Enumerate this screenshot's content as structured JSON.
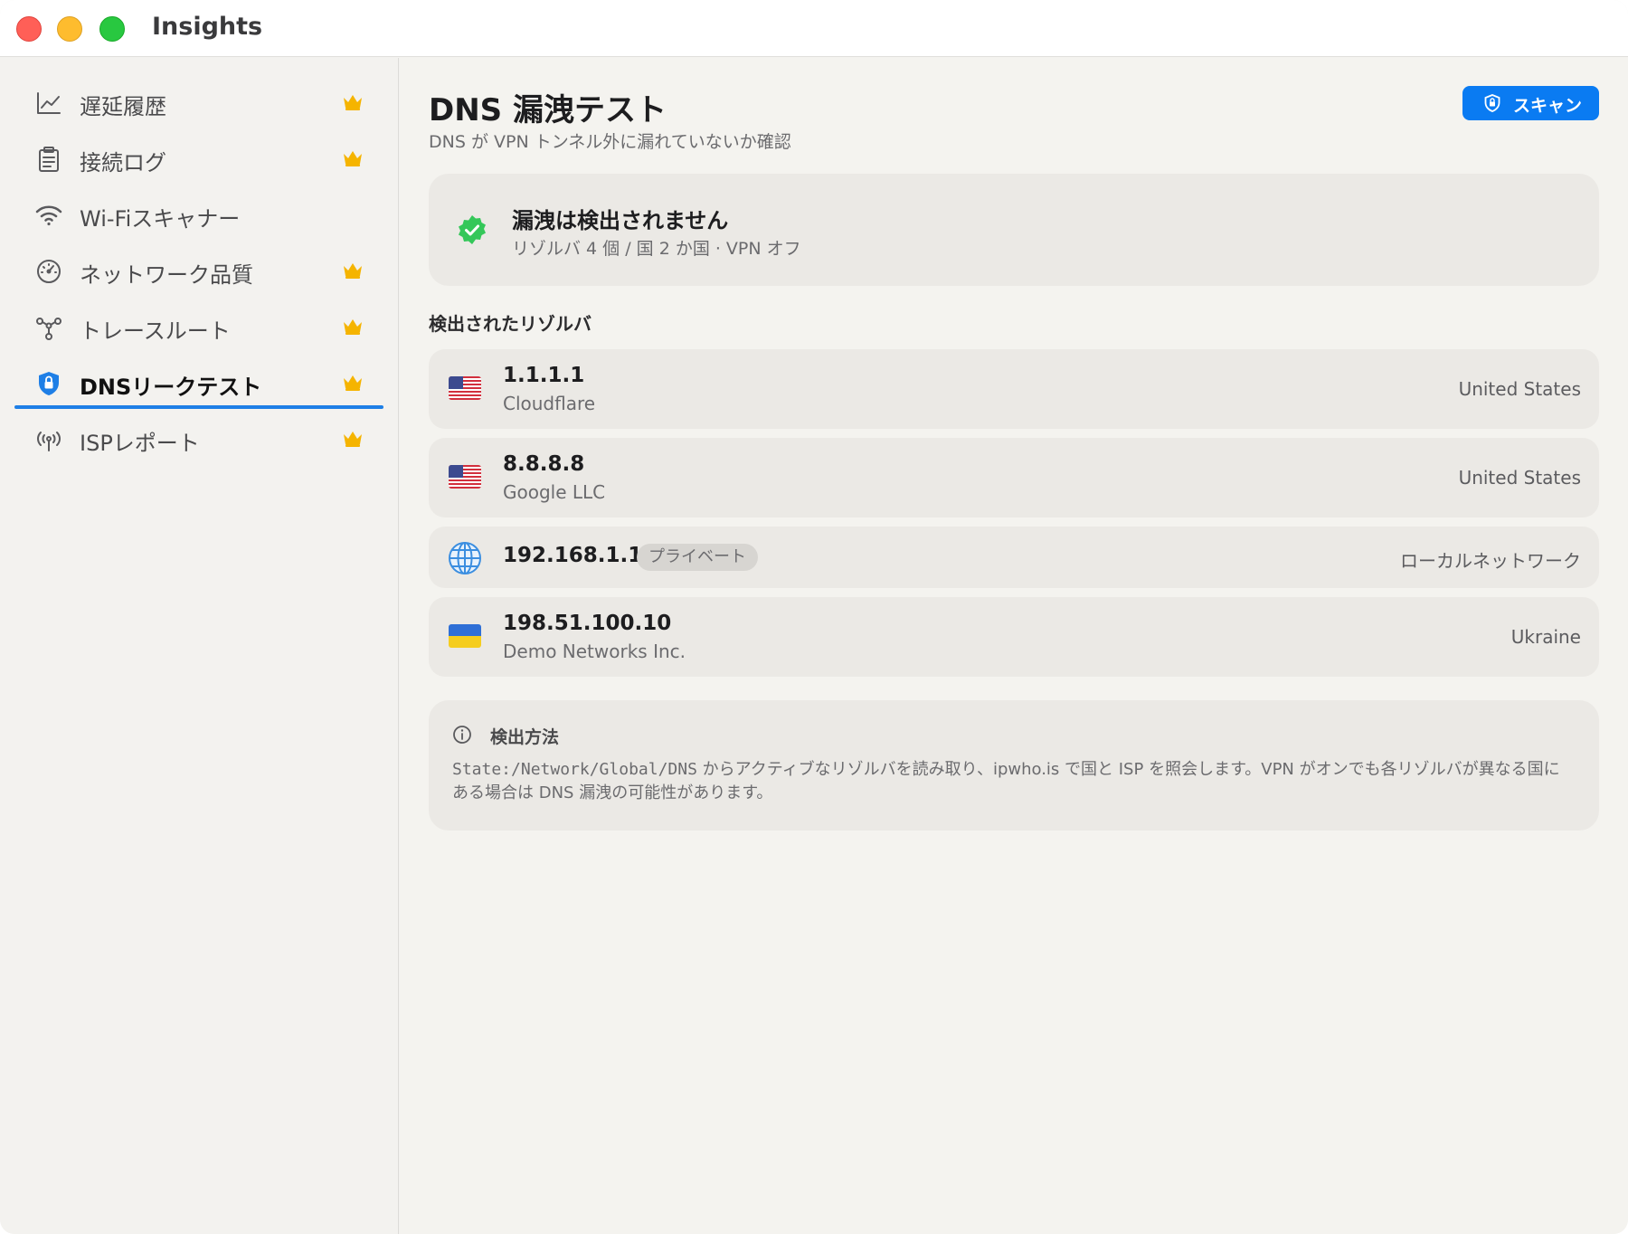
{
  "window": {
    "title": "Insights"
  },
  "sidebar": {
    "items": [
      {
        "label": "遅延履歴",
        "icon": "chart-line-icon",
        "premium": true
      },
      {
        "label": "接続ログ",
        "icon": "clipboard-list-icon",
        "premium": true
      },
      {
        "label": "Wi-Fiスキャナー",
        "icon": "wifi-icon",
        "premium": false
      },
      {
        "label": "ネットワーク品質",
        "icon": "gauge-icon",
        "premium": true
      },
      {
        "label": "トレースルート",
        "icon": "route-nodes-icon",
        "premium": true
      },
      {
        "label": "DNSリークテスト",
        "icon": "shield-lock-icon",
        "premium": true,
        "active": true
      },
      {
        "label": "ISPレポート",
        "icon": "antenna-icon",
        "premium": true
      }
    ]
  },
  "main": {
    "title": "DNS 漏洩テスト",
    "subtitle": "DNS が VPN トンネル外に漏れていないか確認",
    "scan_button": {
      "label": "スキャン",
      "icon": "shield-icon"
    },
    "status": {
      "icon": "verified-check-icon",
      "title": "漏洩は検出されません",
      "summary": "リゾルバ 4 個 / 国 2 か国 · VPN オフ"
    },
    "section_title": "検出されたリゾルバ",
    "resolvers": [
      {
        "ip": "1.1.1.1",
        "org": "Cloudflare",
        "country": "United States",
        "flag": "us-flag-icon"
      },
      {
        "ip": "8.8.8.8",
        "org": "Google LLC",
        "country": "United States",
        "flag": "us-flag-icon"
      },
      {
        "ip": "192.168.1.1",
        "badge": "プライベート",
        "country": "ローカルネットワーク",
        "flag": "globe-icon"
      },
      {
        "ip": "198.51.100.10",
        "org": "Demo Networks Inc.",
        "country": "Ukraine",
        "flag": "ua-flag-icon"
      }
    ],
    "info": {
      "icon": "info-circle-icon",
      "title": "検出方法",
      "path": "State:/Network/Global/DNS",
      "body": " からアクティブなリゾルバを読み取り、ipwho.is で国と ISP を照会します。VPN がオンでも各リゾルバが異なる国にある場合は DNS 漏洩の可能性があります。"
    }
  },
  "colors": {
    "accent": "#0a7bf2",
    "success": "#34c759",
    "premium_crown": "#f5b400",
    "active_underline": "#1e7fe6"
  }
}
